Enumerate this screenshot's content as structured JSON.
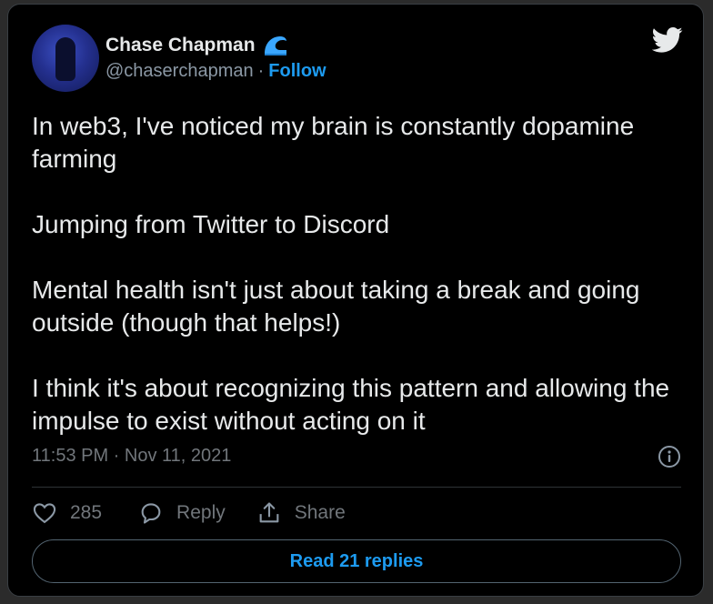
{
  "author": {
    "display_name": "Chase Chapman",
    "handle": "@chaserchapman",
    "separator": "·",
    "follow_label": "Follow",
    "badge_icon": "wave-icon"
  },
  "tweet": {
    "paragraphs": [
      "In web3, I've noticed my brain is constantly dopamine farming",
      "Jumping from Twitter to Discord",
      "Mental health isn't just about taking a break and going outside (though that helps!)",
      "I think it's about recognizing this pattern and allowing the impulse to exist without acting on it"
    ],
    "timestamp": "11:53 PM · Nov 11, 2021"
  },
  "actions": {
    "like_count": "285",
    "reply_label": "Reply",
    "share_label": "Share"
  },
  "read_replies_label": "Read 21 replies",
  "colors": {
    "background": "#000000",
    "text": "#e7e9ea",
    "muted": "#71767b",
    "accent": "#1d9bf0"
  },
  "icons": [
    "twitter-bird-icon",
    "info-icon",
    "heart-icon",
    "reply-bubble-icon",
    "share-icon",
    "wave-icon"
  ]
}
